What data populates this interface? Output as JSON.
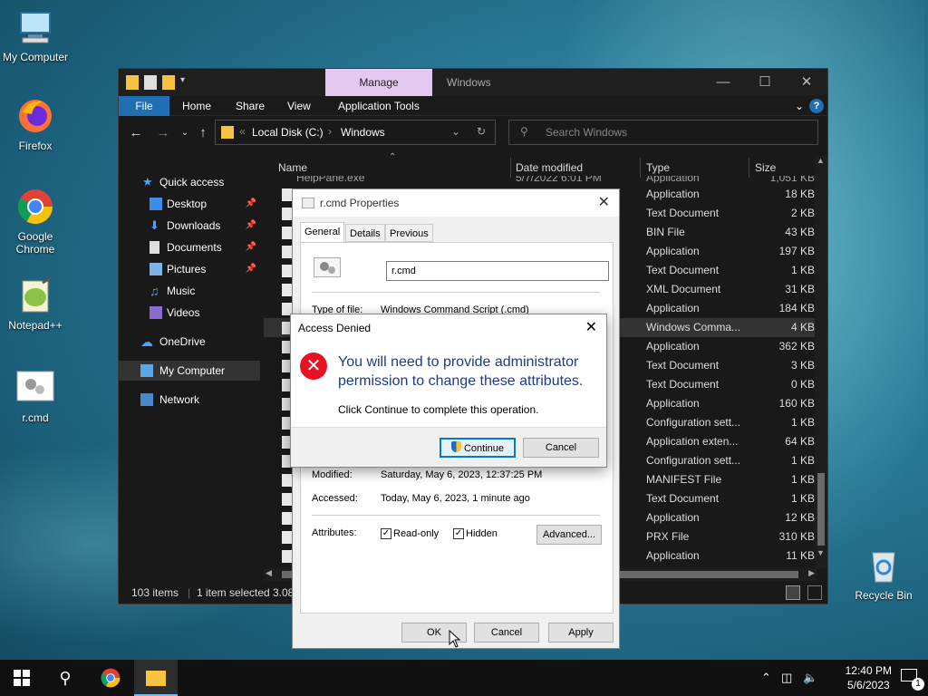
{
  "desktop": {
    "icons": [
      {
        "label": "My Computer"
      },
      {
        "label": "Firefox"
      },
      {
        "label": "Google Chrome"
      },
      {
        "label": "Notepad++"
      },
      {
        "label": "r.cmd"
      },
      {
        "label": "Recycle Bin"
      }
    ]
  },
  "explorer": {
    "title": "Windows",
    "manage_tab": "Manage",
    "ribbon_tabs": [
      "File",
      "Home",
      "Share",
      "View",
      "Application Tools"
    ],
    "address": {
      "crumb1": "Local Disk (C:)",
      "crumb2": "Windows"
    },
    "search_placeholder": "Search Windows",
    "nav": [
      {
        "label": "Quick access"
      },
      {
        "label": "Desktop"
      },
      {
        "label": "Downloads"
      },
      {
        "label": "Documents"
      },
      {
        "label": "Pictures"
      },
      {
        "label": "Music"
      },
      {
        "label": "Videos"
      },
      {
        "label": "OneDrive"
      },
      {
        "label": "My Computer"
      },
      {
        "label": "Network"
      }
    ],
    "columns": {
      "name": "Name",
      "date": "Date modified",
      "type": "Type",
      "size": "Size"
    },
    "partial_first_row": {
      "name": "HelpPane.exe",
      "date": "5/7/2022 6:01 PM",
      "type": "Application",
      "size": "1,051 KB"
    },
    "rows": [
      {
        "type": "Application",
        "size": "18 KB"
      },
      {
        "type": "Text Document",
        "size": "2 KB"
      },
      {
        "type": "BIN File",
        "size": "43 KB"
      },
      {
        "type": "Application",
        "size": "197 KB"
      },
      {
        "type": "Text Document",
        "size": "1 KB"
      },
      {
        "type": "XML Document",
        "size": "31 KB"
      },
      {
        "type": "Application",
        "size": "184 KB"
      },
      {
        "type": "Windows Comma...",
        "size": "4 KB"
      },
      {
        "type": "Application",
        "size": "362 KB"
      },
      {
        "type": "Text Document",
        "size": "3 KB"
      },
      {
        "type": "Text Document",
        "size": "0 KB"
      },
      {
        "type": "Application",
        "size": "160 KB"
      },
      {
        "type": "Configuration sett...",
        "size": "1 KB"
      },
      {
        "type": "Application exten...",
        "size": "64 KB"
      },
      {
        "type": "Configuration sett...",
        "size": "1 KB"
      },
      {
        "type": "MANIFEST File",
        "size": "1 KB"
      },
      {
        "type": "Text Document",
        "size": "1 KB"
      },
      {
        "type": "Application",
        "size": "12 KB"
      },
      {
        "type": "PRX File",
        "size": "310 KB"
      },
      {
        "type": "Application",
        "size": "11 KB"
      }
    ],
    "status": {
      "count": "103 items",
      "selected": "1 item selected",
      "size": "3.08"
    }
  },
  "properties": {
    "title": "r.cmd Properties",
    "tabs": [
      "General",
      "Details",
      "Previous Versions"
    ],
    "filename": "r.cmd",
    "type_label": "Type of file:",
    "type_value": "Windows Command Script (.cmd)",
    "modified_label": "Modified:",
    "modified_value": "Saturday, May 6, 2023, 12:37:25 PM",
    "accessed_label": "Accessed:",
    "accessed_value": "Today, May 6, 2023, 1 minute ago",
    "attributes_label": "Attributes:",
    "readonly_label": "Read-only",
    "hidden_label": "Hidden",
    "advanced_label": "Advanced...",
    "ok": "OK",
    "cancel": "Cancel",
    "apply": "Apply"
  },
  "denied": {
    "title": "Access Denied",
    "message": "You will need to provide administrator permission to change these attributes.",
    "sub": "Click Continue to complete this operation.",
    "continue": "Continue",
    "cancel": "Cancel"
  },
  "taskbar": {
    "time": "12:40 PM",
    "date": "5/6/2023",
    "notif_count": "1"
  }
}
